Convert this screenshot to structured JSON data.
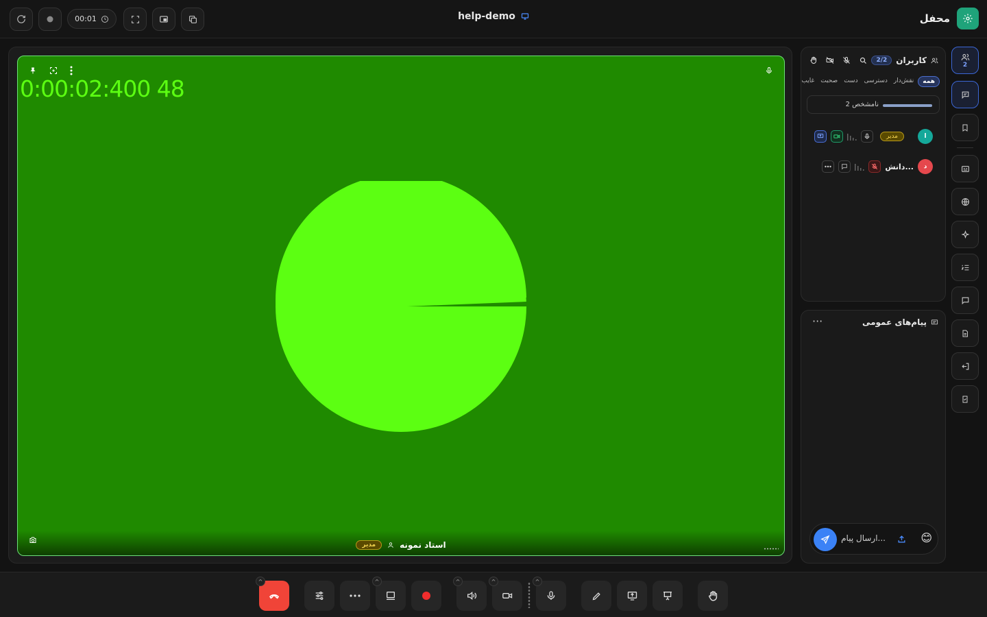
{
  "topbar": {
    "timer": "00:01",
    "room_title": "help-demo",
    "brand_name": "محفل",
    "icons": [
      "refresh-icon",
      "record-dot-icon",
      "clock-icon",
      "fullscreen-icon",
      "picture-in-picture-icon",
      "copy-icon",
      "monitor-icon"
    ]
  },
  "stage": {
    "timecode": "0:00:02:400 48",
    "speaker_name": "استاد نمونه",
    "speaker_role": "مدیر",
    "video_color": "#1f8a00",
    "circle_color": "#5cff12"
  },
  "users_panel": {
    "title": "کاربران",
    "count": "2/2",
    "filters": [
      "همه",
      "نقش‌دار",
      "دسترسی",
      "دست",
      "صحبت",
      "غایب"
    ],
    "active_filter": "همه",
    "unknown_label": "2 نامشخص",
    "users": [
      {
        "initial": "ا",
        "role": "مدیر",
        "avatar_color": "#15a89a"
      },
      {
        "initial": "د",
        "name": "دانش...",
        "avatar_color": "#e5484d"
      }
    ]
  },
  "chat_panel": {
    "title": "پیام‌های عمومی",
    "more": "···",
    "input_placeholder": "ارسال پیام...",
    "emoji": "😊"
  },
  "rail": {
    "participants_count": "2",
    "icons": [
      "users-icon",
      "chat-icon",
      "bookmark-icon",
      "captions-icon",
      "globe-icon",
      "sparkle-icon",
      "list-icon",
      "message-icon",
      "file-icon",
      "exit-icon",
      "checklist-icon"
    ]
  },
  "bottombar": {
    "buttons": [
      "end-call",
      "settings",
      "more",
      "layout",
      "record",
      "speaker",
      "camera",
      "microphone",
      "pen",
      "share-screen",
      "presentation",
      "raise-hand"
    ]
  }
}
